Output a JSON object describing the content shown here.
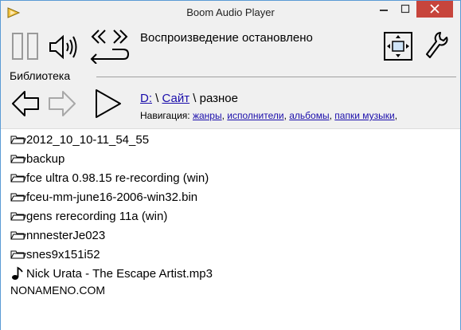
{
  "window": {
    "title": "Boom Audio Player",
    "controls": [
      "minimize",
      "maximize",
      "close"
    ]
  },
  "toolbar": {
    "status_text": "Воспроизведение остановлено",
    "icons": [
      "pause-icon",
      "volume-icon",
      "repeat-icon",
      "fit-window-icon",
      "settings-wrench-icon"
    ]
  },
  "library": {
    "label": "Библиотека",
    "path": {
      "drive": "D:",
      "sep1": "\\",
      "folder": "Сайт",
      "sep2": "\\",
      "current": "разное"
    },
    "navigation": {
      "label": "Навигация:",
      "links": [
        "жанры",
        "исполнители",
        "альбомы",
        "папки музыки"
      ],
      "trailing": ","
    },
    "items": [
      {
        "type": "folder",
        "name": "2012_10_10-11_54_55"
      },
      {
        "type": "folder",
        "name": "backup"
      },
      {
        "type": "folder",
        "name": "fce ultra 0.98.15 re-recording (win)"
      },
      {
        "type": "folder",
        "name": "fceu-mm-june16-2006-win32.bin"
      },
      {
        "type": "folder",
        "name": "gens rerecording 11a (win)"
      },
      {
        "type": "folder",
        "name": "nnnesterJe023"
      },
      {
        "type": "folder",
        "name": "snes9x151i52"
      },
      {
        "type": "audio",
        "name": "Nick Urata - The Escape Artist.mp3"
      }
    ],
    "footer": "NONAMENO.COM"
  }
}
